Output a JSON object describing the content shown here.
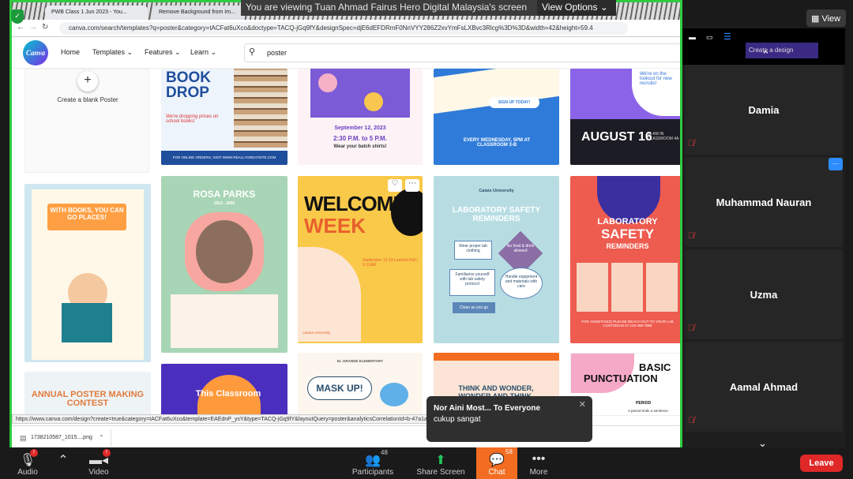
{
  "zoom_banner": {
    "text": "You are viewing Tuan Ahmad Fairus Hero Digital Malaysia's screen",
    "view_options": "View Options",
    "view_button": "View"
  },
  "browser": {
    "tabs": [
      {
        "label": "PWB Class 1 Jun 2023 - You..."
      },
      {
        "label": "Remove Background from Im..."
      }
    ],
    "url": "canva.com/search/templates?q=poster&category=tACFat6uXco&doctype=TACQ-jGq9fY&designSpec=djE6dEFDRmF0NnVYY286Z2xvYmFsLXBvc3Rlcg%3D%3D&width=42&height=59.4",
    "status_url": "https://www.canva.com/design?create=true&category=tACFat6uXco&template=EAEdnP_ysY&type=TACQ-jGq9fY&layoutQuery=poster&analyticsCorrelationId=b-47a1a1...",
    "download_item": "1738210587_1015....png"
  },
  "canva": {
    "logo": "Canva",
    "nav": [
      "Home",
      "Templates",
      "Features",
      "Learn"
    ],
    "search_value": "poster",
    "create_blank": "Create a blank Poster",
    "cards": {
      "book_drop": {
        "title": "BOOK DROP",
        "sub": "We're dropping prices on school books!",
        "footer": "FOR ONLINE ORDERS, VISIT WWW.REALLYGREATSITE.COM"
      },
      "batch": {
        "date": "September 12, 2023",
        "time": "2:30 P.M. to 5 P.M.",
        "note": "Wear your batch shirts!"
      },
      "signup": {
        "btn": "SIGN UP TODAY!",
        "when": "EVERY WEDNESDAY, 5PM AT CLASSROOM 3-B"
      },
      "tryouts": {
        "head": "We're on the lookout for new recruits!",
        "date": "AUGUST 16",
        "info": "11 AM IN CLASSROOM 4A"
      },
      "books": {
        "title": "WITH BOOKS, YOU CAN GO PLACES!"
      },
      "rosa": {
        "name": "ROSA PARKS",
        "years": "1913 - 2005"
      },
      "welcome": {
        "line1": "WELCOME",
        "line2": "WEEK",
        "info": "September 15-19 Lanford Hall | 9-11AM",
        "brand": "Larana University"
      },
      "safety_blue": {
        "school": "Calais University",
        "title": "LABORATORY SAFETY REMINDERS",
        "items": [
          "Wear proper lab clothing",
          "No food & drink allowed",
          "Familiarize yourself with lab safety protocol",
          "Handle equipment and materials with care",
          "Clean as you go"
        ]
      },
      "safety_red": {
        "title1": "LABORATORY",
        "title2": "SAFETY",
        "title3": "REMINDERS",
        "footer": "FOR ASSISTANCE PLEASE REACH OUT TO YOUR LAB CUSTODIAN AT 123-456-7890"
      },
      "contest": {
        "title": "ANNUAL POSTER MAKING CONTEST"
      },
      "classroom": {
        "title": "This Classroom"
      },
      "mask": {
        "title": "MASK UP!",
        "school": "EL GRANDE ELEMENTARY"
      },
      "think": {
        "title": "THINK AND WONDER, WONDER AND THINK."
      },
      "punct": {
        "title1": "BASIC",
        "title2": "PUNCTUATION",
        "word": "PERIOD",
        "desc": "A period ends a sentence."
      }
    }
  },
  "participants_panel": {
    "tiles": [
      {
        "name": "Damia"
      },
      {
        "name": "Muhammad Nauran"
      },
      {
        "name": "Uzma"
      },
      {
        "name": "Aamal Ahmad"
      }
    ],
    "chrome_btn": "Create a design"
  },
  "chat_toast": {
    "from": "Nor Aini Most... To Everyone",
    "message": "cukup sangat"
  },
  "toolbar": {
    "audio": "Audio",
    "video": "Video",
    "participants": "Participants",
    "participants_count": "48",
    "share": "Share Screen",
    "chat": "Chat",
    "chat_count": "58",
    "more": "More",
    "leave": "Leave"
  },
  "colors": {
    "share_border": "#2ecc40",
    "leave": "#e02828",
    "chat_active": "#f26d21",
    "canva_accent": "#7d2ae8"
  }
}
